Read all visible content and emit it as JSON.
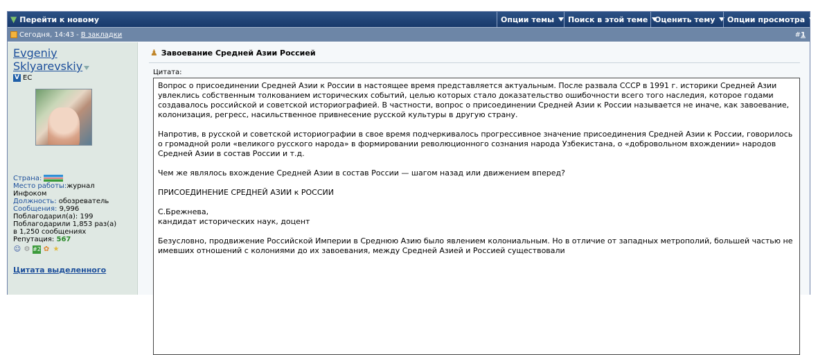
{
  "topbar": {
    "go_new": "Перейти к новому",
    "menus": [
      "Опции темы",
      "Поиск в этой теме",
      "Оценить тему",
      "Опции просмотра"
    ]
  },
  "datebar": {
    "date": "Сегодня, 14:43",
    "sep": " - ",
    "bookmark": "В закладки",
    "num_prefix": "#",
    "num": "1"
  },
  "user": {
    "name_line1": "Evgeniy",
    "name_line2": "Sklyarevskiy",
    "badge": "V",
    "badge_label": "EC",
    "country_label": "Страна:",
    "work_label": "Место работы:",
    "work_value_line1": "журнал",
    "work_value_line2": "Инфоком",
    "position_label": "Должность:",
    "position_value": "обозреватель",
    "posts_label": "Сообщения:",
    "posts_value": "9,996",
    "thanked": "Поблагодарил(а): 199",
    "thanked_by_line1": "Поблагодарили 1,853 раз(а)",
    "thanked_by_line2": "в 1,250 сообщениях",
    "rep_label": "Репутация:",
    "rep_value": "567",
    "quote_selected": "Цитата выделенного"
  },
  "post": {
    "title": "Завоевание Средней Азии Россией",
    "quote_label": "Цитата:",
    "paragraphs": [
      "Вопрос о присоединении Средней Азии к России в настоящее время представляется актуальным. После развала СССР в 1991 г. историки Средней Азии увлеклись собственным толкованием исторических событий, целью которых стало доказательство ошибочности всего того наследия, которое годами создавалось российской и советской историографией. В частности, вопрос о присоединении Средней Азии к России называется не иначе, как завоевание, колонизация, регресс, насильственное привнесение русской культуры в другую страну.",
      "Напротив, в русской и советской историографии в свое время подчеркивалось прогрессивное значение присоединения Средней Азии к России, говорилось о громадной роли «великого русского народа» в формировании революционного сознания народа Узбекистана, о «добровольном вхождении» народов Средней Азии в состав России и т.д.",
      "Чем же являлось вхождение Средней Азии в состав России — шагом назад или движением вперед?",
      "ПРИСОЕДИНЕНИЕ СРЕДНЕЙ АЗИИ к РОССИИ"
    ],
    "author_line1": "С.Брежнева,",
    "author_line2": "кандидат исторических наук, доцент",
    "last_paragraph": "Безусловно, продвижение Российской Империи в Среднюю Азию было явлением колониальным. Но в отличие от западных метрополий, большей частью не имевших отношений с колониями до их завоевания, между Средней Азией и Россией существовали"
  }
}
